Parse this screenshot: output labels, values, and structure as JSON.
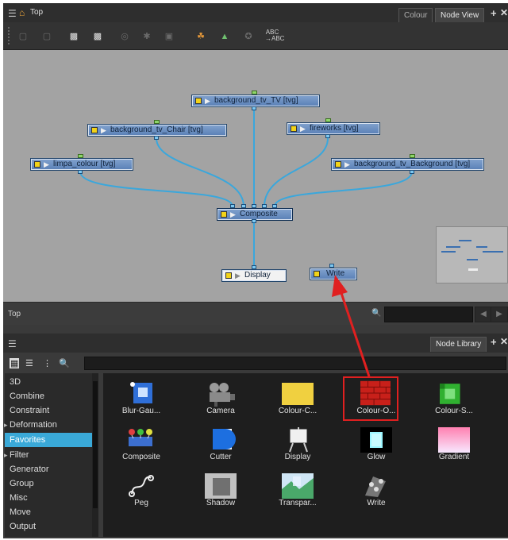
{
  "node_view": {
    "breadcrumb": "Top",
    "tabs": [
      {
        "label": "Colour",
        "active": false
      },
      {
        "label": "Node View",
        "active": true
      }
    ],
    "toolbar_abc": "ABC\n→ABC",
    "nodes": {
      "tv": "background_tv_TV  [tvg]",
      "chair": "background_tv_Chair  [tvg]",
      "fireworks": "fireworks  [tvg]",
      "limpa": "limpa_colour  [tvg]",
      "bg": "background_tv_Background  [tvg]",
      "composite": "Composite",
      "display": "Display",
      "write": "Write"
    },
    "status_text": "Top"
  },
  "node_library": {
    "tab_label": "Node Library",
    "categories": [
      {
        "label": "3D",
        "expandable": false,
        "selected": false
      },
      {
        "label": "Combine",
        "expandable": false,
        "selected": false
      },
      {
        "label": "Constraint",
        "expandable": false,
        "selected": false
      },
      {
        "label": "Deformation",
        "expandable": true,
        "selected": false
      },
      {
        "label": "Favorites",
        "expandable": false,
        "selected": true
      },
      {
        "label": "Filter",
        "expandable": true,
        "selected": false
      },
      {
        "label": "Generator",
        "expandable": false,
        "selected": false
      },
      {
        "label": "Group",
        "expandable": false,
        "selected": false
      },
      {
        "label": "Misc",
        "expandable": false,
        "selected": false
      },
      {
        "label": "Move",
        "expandable": false,
        "selected": false
      },
      {
        "label": "Output",
        "expandable": false,
        "selected": false
      }
    ],
    "items": [
      {
        "label": "Blur-Gau...",
        "icon": "blur-gaussian-icon"
      },
      {
        "label": "Camera",
        "icon": "camera-icon"
      },
      {
        "label": "Colour-C...",
        "icon": "colour-card-icon"
      },
      {
        "label": "Colour-O...",
        "icon": "colour-override-icon",
        "highlighted": true
      },
      {
        "label": "Colour-S...",
        "icon": "colour-scale-icon"
      },
      {
        "label": "Composite",
        "icon": "composite-icon"
      },
      {
        "label": "Cutter",
        "icon": "cutter-icon"
      },
      {
        "label": "Display",
        "icon": "display-icon"
      },
      {
        "label": "Glow",
        "icon": "glow-icon"
      },
      {
        "label": "Gradient",
        "icon": "gradient-icon"
      },
      {
        "label": "Peg",
        "icon": "peg-icon"
      },
      {
        "label": "Shadow",
        "icon": "shadow-icon"
      },
      {
        "label": "Transpar...",
        "icon": "transparency-icon"
      },
      {
        "label": "Write",
        "icon": "write-icon"
      }
    ]
  },
  "colors": {
    "node_fill": "#6a8fc4",
    "connection": "#3aa7dc",
    "selection": "#3aa9d8",
    "annotation": "#e02020"
  }
}
